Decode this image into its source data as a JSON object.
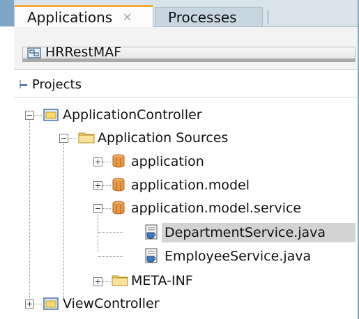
{
  "tabs": [
    {
      "label": "Applications",
      "close": "×"
    },
    {
      "label": "Processes"
    }
  ],
  "application": {
    "name": "HRRestMAF"
  },
  "panel": {
    "title": "Projects"
  },
  "tree": [
    {
      "label": "ApplicationController",
      "icon": "project-folder-icon",
      "expanded": true
    },
    {
      "label": "Application Sources",
      "icon": "folder-icon",
      "expanded": true
    },
    {
      "label": "application",
      "icon": "package-icon",
      "expanded": false
    },
    {
      "label": "application.model",
      "icon": "package-icon",
      "expanded": false
    },
    {
      "label": "application.model.service",
      "icon": "package-icon",
      "expanded": true
    },
    {
      "label": "DepartmentService.java",
      "icon": "java-class-icon",
      "selected": true
    },
    {
      "label": "EmployeeService.java",
      "icon": "java-class-icon"
    },
    {
      "label": "META-INF",
      "icon": "folder-icon",
      "expanded": false
    },
    {
      "label": "ViewController",
      "icon": "project-folder-icon",
      "expanded": false
    }
  ],
  "colors": {
    "active_tab_accent": "#f4a93a",
    "selection": "#d3d3d3",
    "tabbar": "#d9e4ea"
  }
}
